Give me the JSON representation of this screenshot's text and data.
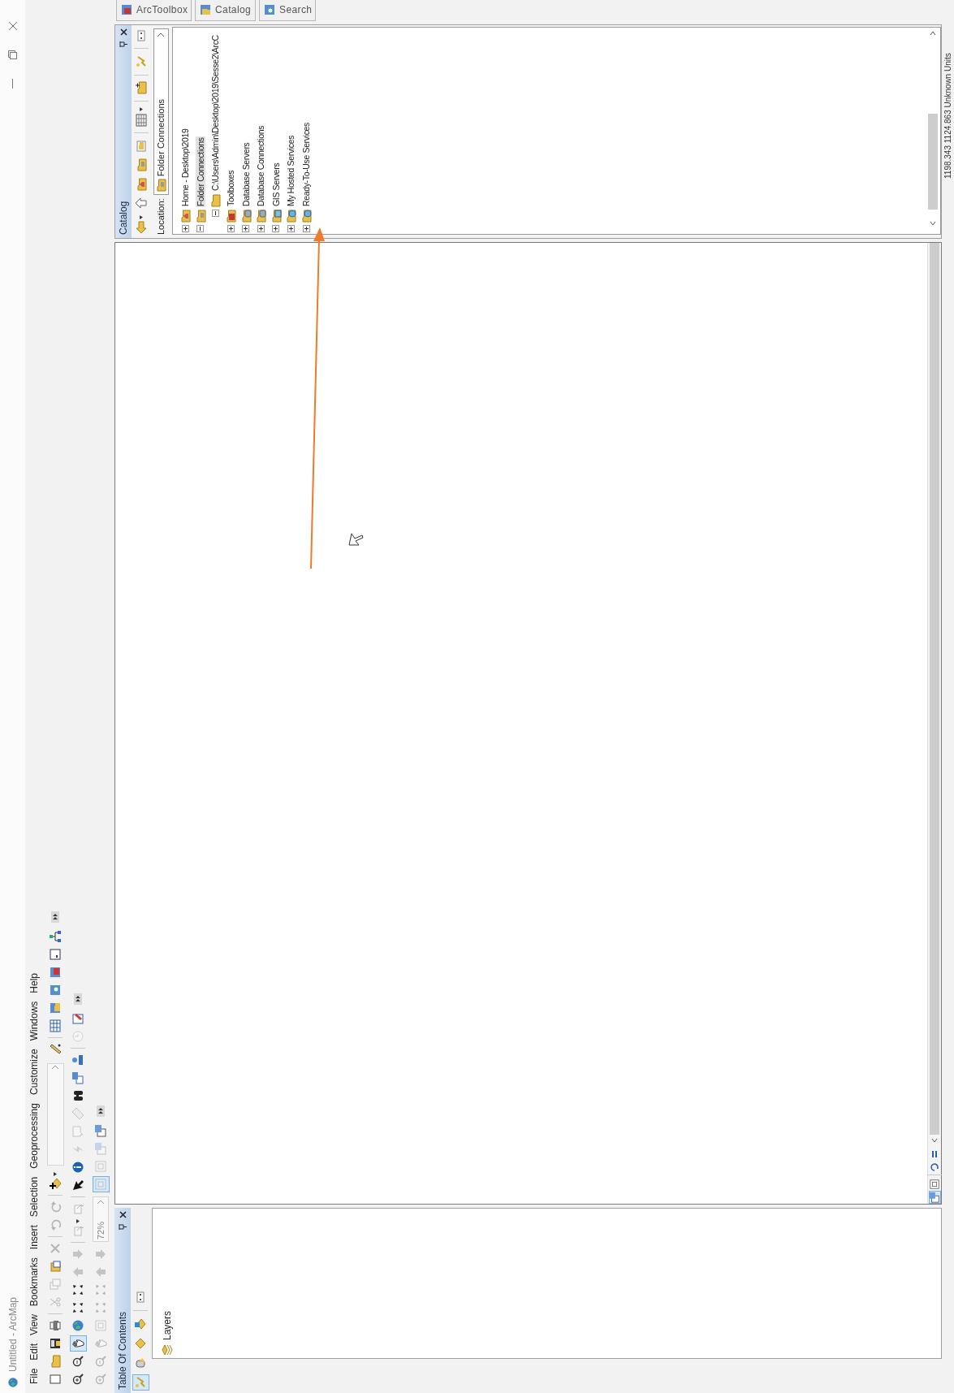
{
  "window": {
    "title": "Untitled - ArcMap"
  },
  "menu": [
    "File",
    "Edit",
    "View",
    "Bookmarks",
    "Insert",
    "Selection",
    "Geoprocessing",
    "Customize",
    "Windows",
    "Help"
  ],
  "toolbars": [
    {
      "buttons": [
        {
          "disabled": false,
          "selected": false
        },
        {
          "disabled": false,
          "selected": false
        },
        {
          "disabled": false,
          "selected": false
        },
        {
          "disabled": false,
          "selected": false
        },
        {
          "disabled": true,
          "selected": false
        },
        {
          "disabled": true,
          "selected": false
        },
        {
          "disabled": false,
          "selected": false
        },
        {
          "disabled": true,
          "selected": false
        },
        {
          "disabled": true,
          "selected": false
        },
        {
          "disabled": true,
          "selected": false
        },
        {
          "disabled": false,
          "selected": false
        },
        {
          "disabled": false,
          "selected": false
        },
        {
          "disabled": false,
          "selected": false
        },
        {
          "disabled": false,
          "selected": false
        },
        {
          "disabled": false,
          "selected": false
        },
        {
          "disabled": false,
          "selected": false
        },
        {
          "disabled": false,
          "selected": false
        },
        {
          "disabled": false,
          "selected": false
        }
      ]
    },
    {
      "buttons": [
        {
          "disabled": false,
          "selected": false
        },
        {
          "disabled": false,
          "selected": false
        },
        {
          "disabled": false,
          "selected": true
        },
        {
          "disabled": false,
          "selected": false
        },
        {
          "disabled": false,
          "selected": false
        },
        {
          "disabled": false,
          "selected": false
        },
        {
          "disabled": true,
          "selected": false
        },
        {
          "disabled": true,
          "selected": false
        },
        {
          "disabled": true,
          "selected": false
        },
        {
          "disabled": true,
          "selected": false
        },
        {
          "disabled": false,
          "selected": false
        },
        {
          "disabled": false,
          "selected": false
        },
        {
          "disabled": true,
          "selected": false
        },
        {
          "disabled": true,
          "selected": false
        },
        {
          "disabled": true,
          "selected": false
        },
        {
          "disabled": false,
          "selected": false
        },
        {
          "disabled": false,
          "selected": false
        },
        {
          "disabled": false,
          "selected": false
        },
        {
          "disabled": true,
          "selected": false
        },
        {
          "disabled": false,
          "selected": false
        }
      ]
    },
    {
      "zoom_field": "72%",
      "buttons": [
        {
          "disabled": true,
          "selected": false
        },
        {
          "disabled": true,
          "selected": false
        },
        {
          "disabled": true,
          "selected": false
        },
        {
          "disabled": true,
          "selected": false
        },
        {
          "disabled": true,
          "selected": false
        },
        {
          "disabled": true,
          "selected": false
        },
        {
          "disabled": true,
          "selected": false
        },
        {
          "disabled": true,
          "selected": false
        },
        {
          "disabled": true,
          "selected": true
        },
        {
          "disabled": true,
          "selected": false
        },
        {
          "disabled": true,
          "selected": false
        },
        {
          "disabled": false,
          "selected": false
        }
      ]
    }
  ],
  "table_of_contents": {
    "title": "Table Of Contents",
    "tools": [
      {
        "selected": true
      },
      {
        "selected": false
      },
      {
        "selected": false
      },
      {
        "selected": false
      }
    ],
    "layers": "Layers"
  },
  "map_view": {
    "view_buttons": [
      {
        "selected": true
      },
      {
        "selected": false
      }
    ]
  },
  "catalog": {
    "title": "Catalog",
    "location_label": "Location:",
    "location": "Folder Connections",
    "tree": [
      {
        "label": "Home - Desktop\\2019",
        "expanded": false,
        "selected": false
      },
      {
        "label": "Folder Connections",
        "expanded": true,
        "selected": true,
        "children": [
          {
            "label": "C:\\Users\\Admin\\Desktop\\2019\\Sesse2\\ArcC",
            "expanded": true,
            "selected": false
          }
        ]
      },
      {
        "label": "Toolboxes",
        "expanded": false,
        "selected": false
      },
      {
        "label": "Database Servers",
        "expanded": false,
        "selected": false
      },
      {
        "label": "Database Connections",
        "expanded": false,
        "selected": false
      },
      {
        "label": "GIS Servers",
        "expanded": false,
        "selected": false
      },
      {
        "label": "My Hosted Services",
        "expanded": false,
        "selected": false
      },
      {
        "label": "Ready-To-Use Services",
        "expanded": false,
        "selected": false
      }
    ]
  },
  "side_tabs": [
    "ArcToolbox",
    "Catalog",
    "Search"
  ],
  "status_bar": "1198.343  1124.863 Unknown Units"
}
